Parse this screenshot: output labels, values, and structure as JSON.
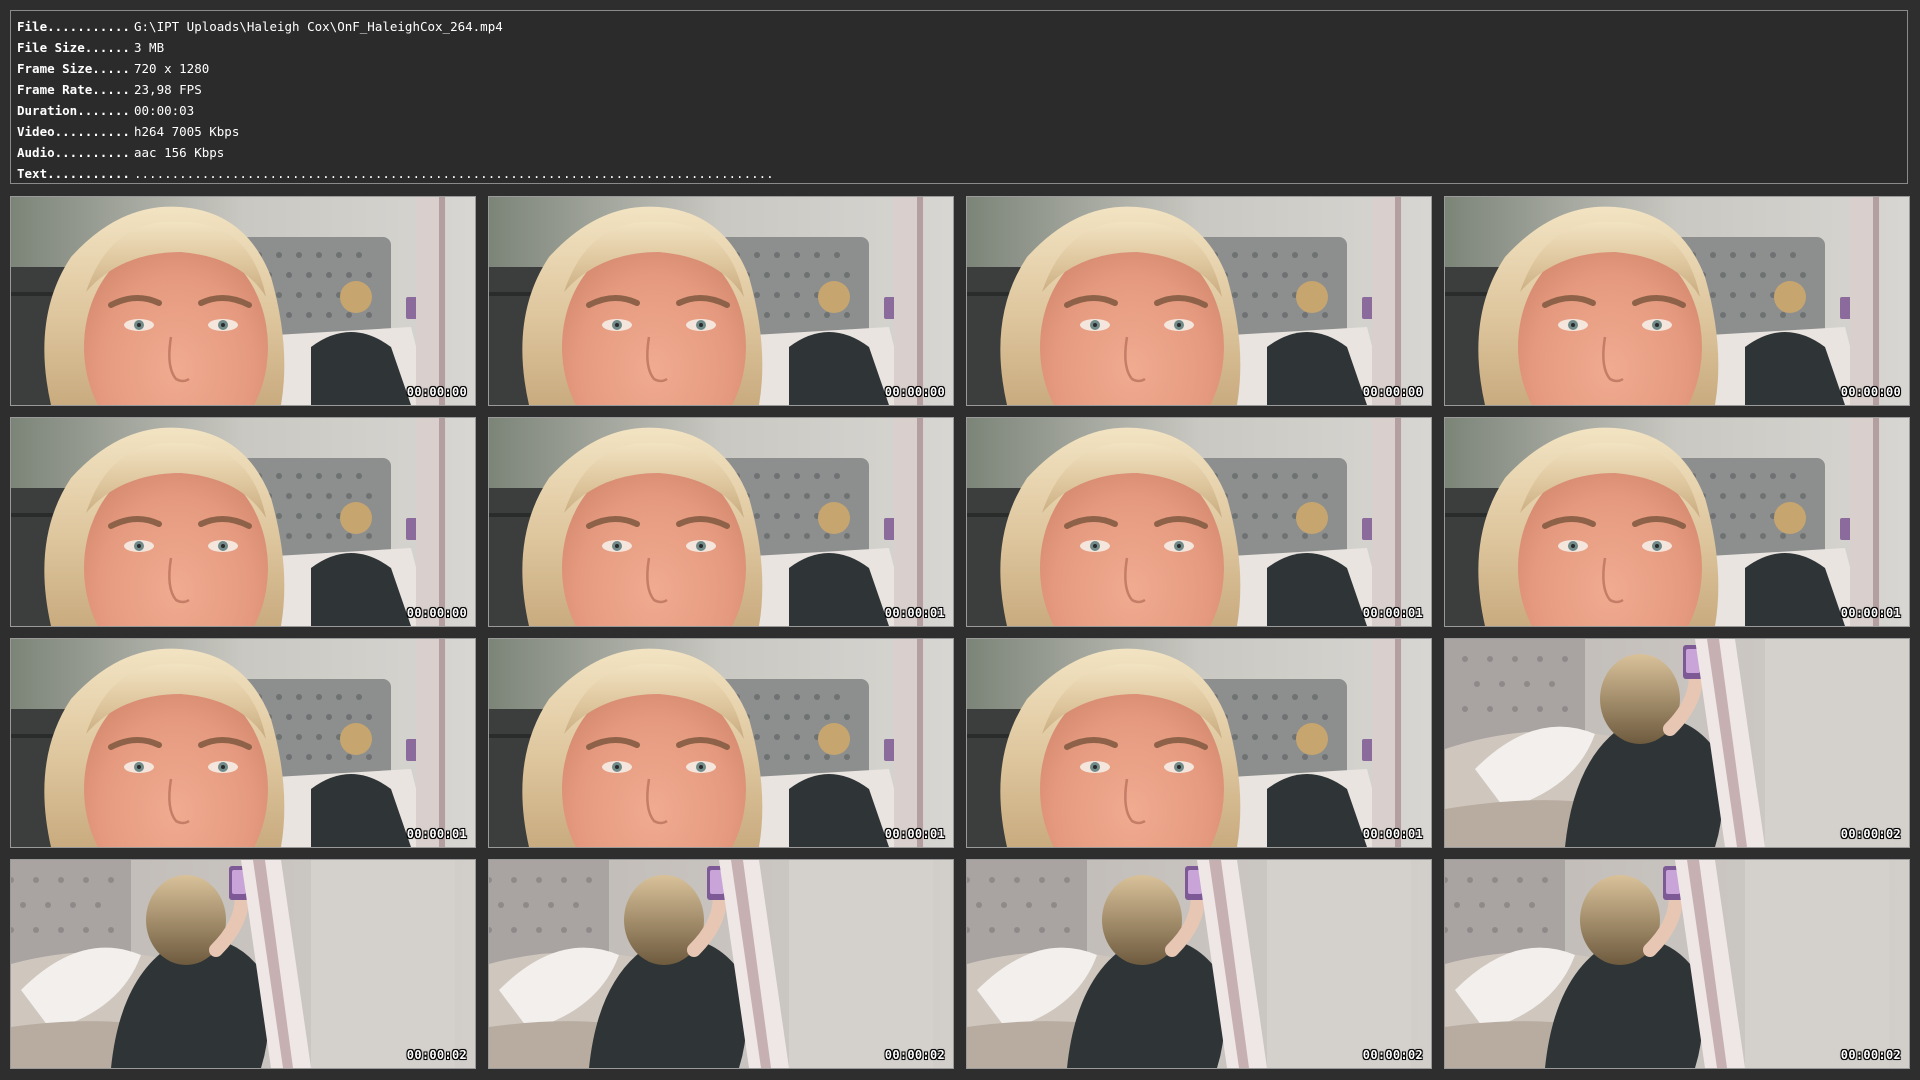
{
  "info": {
    "rows": [
      {
        "key": "File...........",
        "value": "G:\\IPT Uploads\\Haleigh Cox\\OnF_HaleighCox_264.mp4"
      },
      {
        "key": "File Size......",
        "value": "3 MB"
      },
      {
        "key": "Frame Size.....",
        "value": "720 x 1280"
      },
      {
        "key": "Frame Rate.....",
        "value": "23,98 FPS"
      },
      {
        "key": "Duration.......",
        "value": "00:00:03"
      },
      {
        "key": "Video..........",
        "value": "h264 7005 Kbps"
      },
      {
        "key": "Audio..........",
        "value": "aac 156 Kbps"
      },
      {
        "key": "Text...........",
        "value": "....................................................................................."
      }
    ]
  },
  "thumbnails": [
    {
      "timestamp": "00:00:00",
      "scene": "face"
    },
    {
      "timestamp": "00:00:00",
      "scene": "face"
    },
    {
      "timestamp": "00:00:00",
      "scene": "face"
    },
    {
      "timestamp": "00:00:00",
      "scene": "face"
    },
    {
      "timestamp": "00:00:00",
      "scene": "face"
    },
    {
      "timestamp": "00:00:01",
      "scene": "face"
    },
    {
      "timestamp": "00:00:01",
      "scene": "face"
    },
    {
      "timestamp": "00:00:01",
      "scene": "face"
    },
    {
      "timestamp": "00:00:01",
      "scene": "face"
    },
    {
      "timestamp": "00:00:01",
      "scene": "face"
    },
    {
      "timestamp": "00:00:01",
      "scene": "face"
    },
    {
      "timestamp": "00:00:02",
      "scene": "mirror"
    },
    {
      "timestamp": "00:00:02",
      "scene": "mirror"
    },
    {
      "timestamp": "00:00:02",
      "scene": "mirror"
    },
    {
      "timestamp": "00:00:02",
      "scene": "mirror"
    },
    {
      "timestamp": "00:00:02",
      "scene": "mirror"
    }
  ],
  "colors": {
    "background": "#2e2e2e",
    "panel_border": "#8a8a8a",
    "text": "#ffffff"
  }
}
